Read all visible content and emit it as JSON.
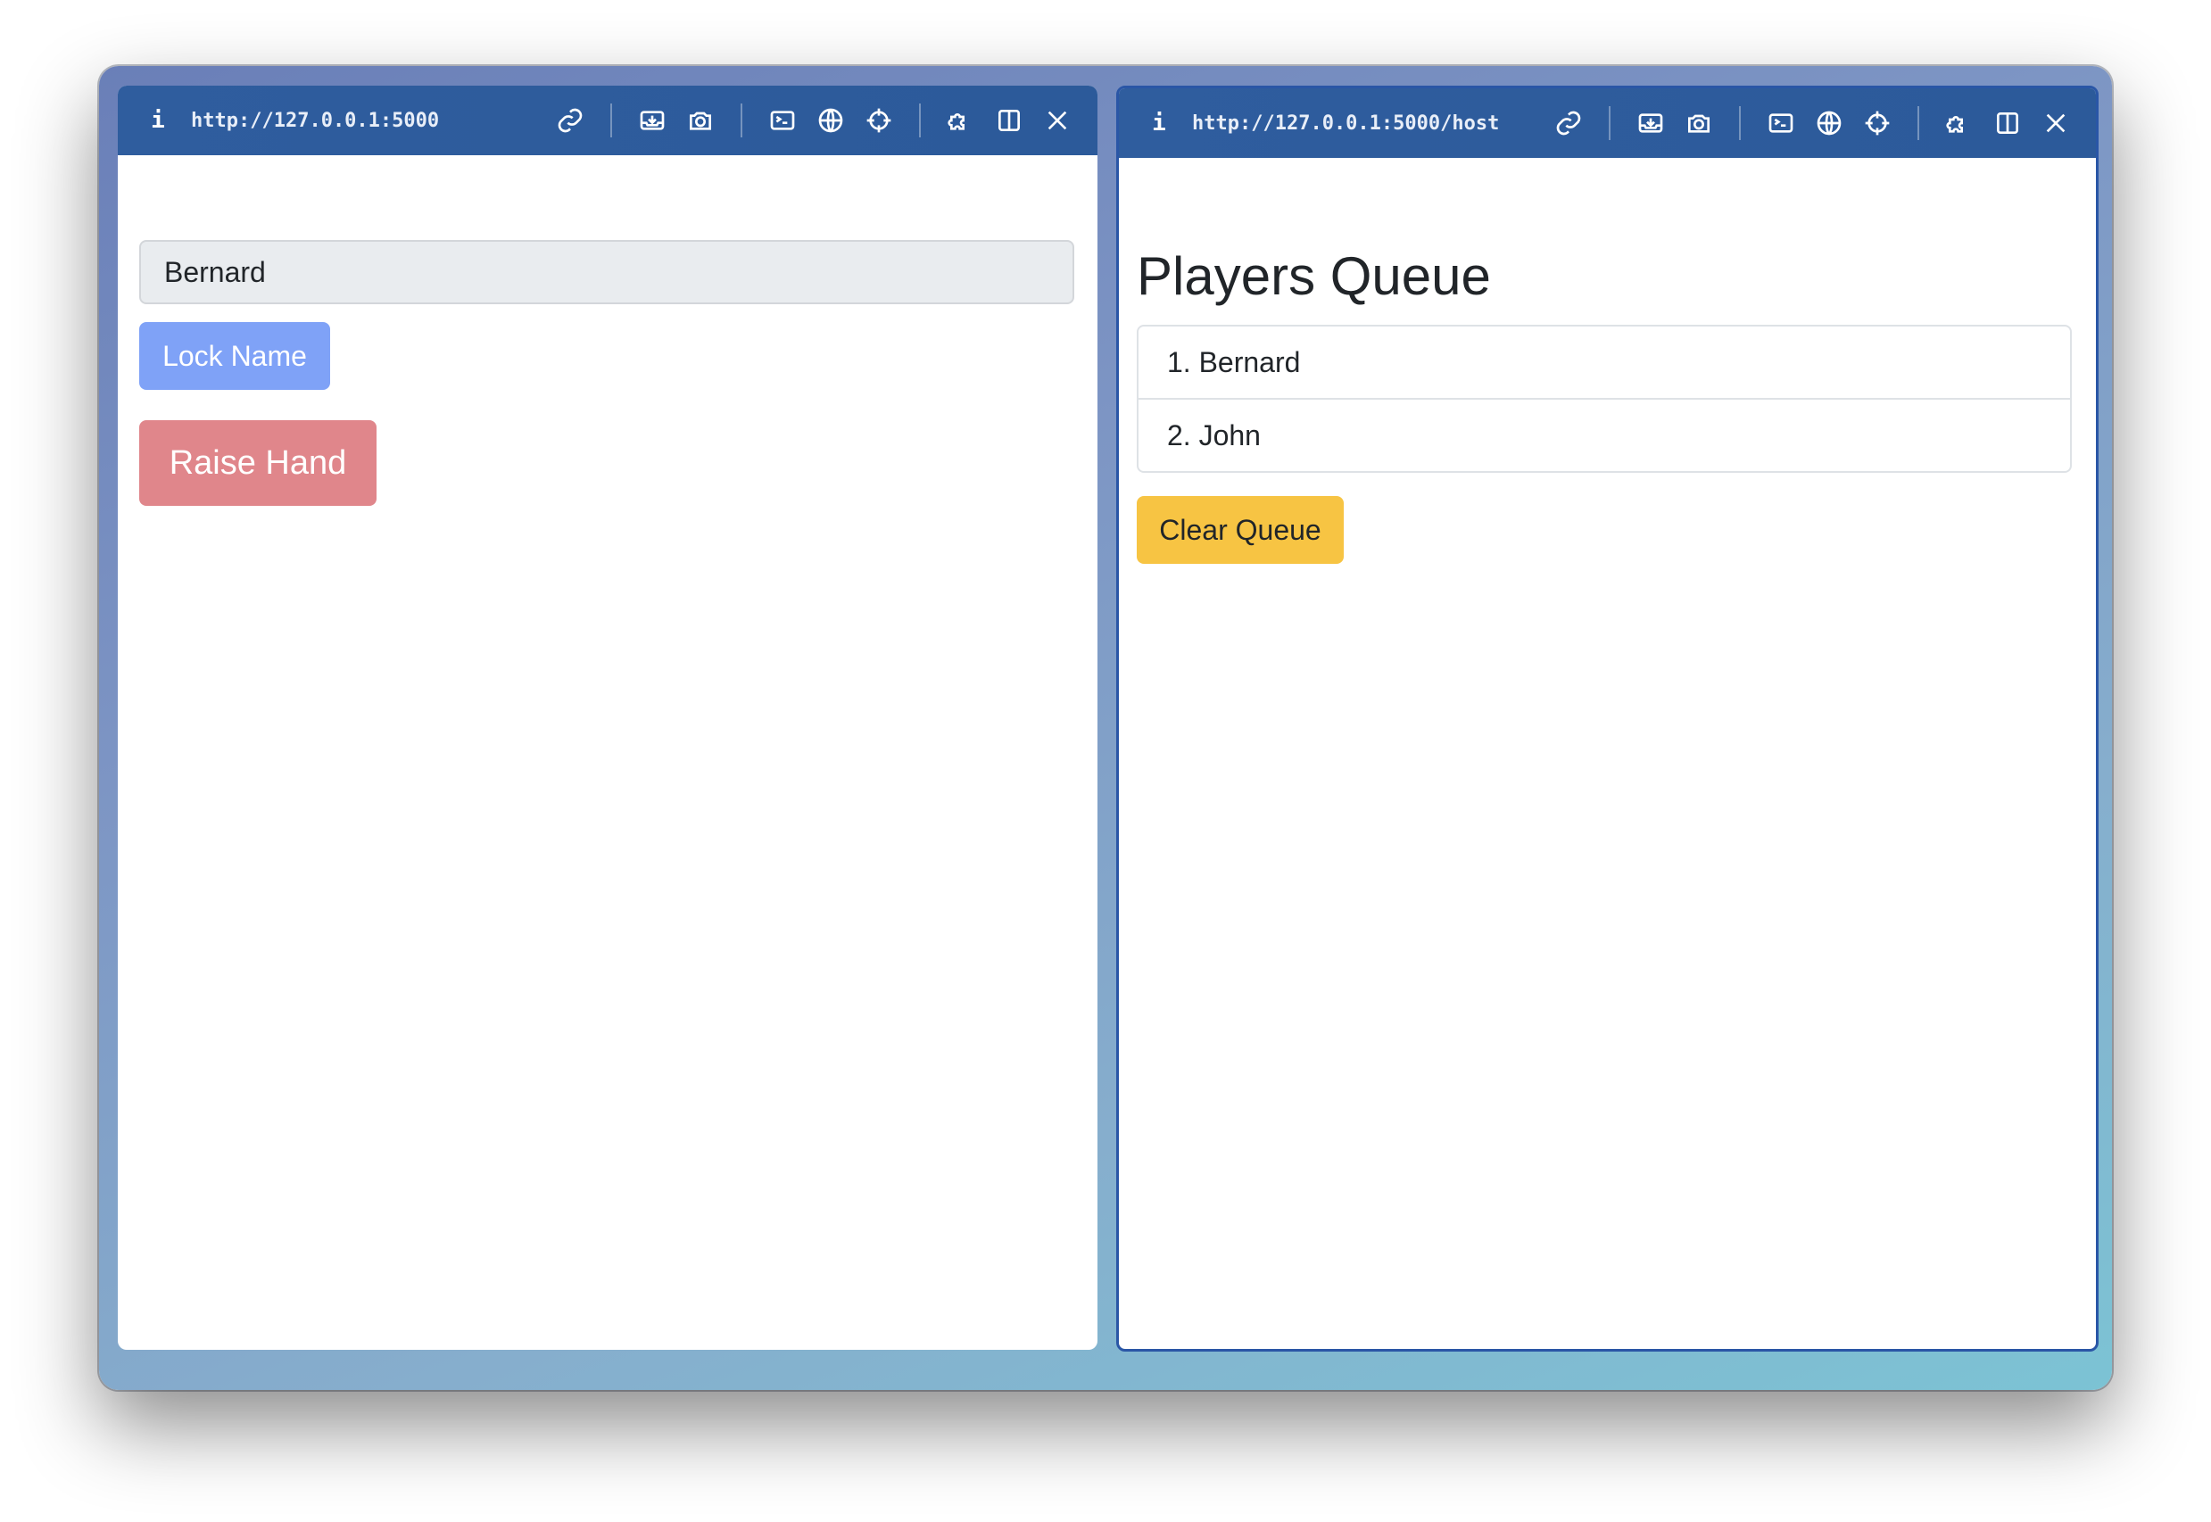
{
  "left_pane": {
    "url": "http://127.0.0.1:5000",
    "name_value": "Bernard",
    "lock_label": "Lock Name",
    "raise_label": "Raise Hand",
    "colors": {
      "lock_button": "#7fa2f7",
      "raise_button": "#e0868b"
    }
  },
  "right_pane": {
    "url": "http://127.0.0.1:5000/host",
    "title": "Players Queue",
    "queue": [
      "1. Bernard",
      "2. John"
    ],
    "clear_label": "Clear Queue",
    "colors": {
      "clear_button": "#f7c443"
    }
  },
  "toolbar": {
    "info_label": "i",
    "icons": [
      "link-icon",
      "inbox-download-icon",
      "camera-icon",
      "terminal-icon",
      "globe-icon",
      "crosshair-icon",
      "puzzle-icon",
      "split-view-icon",
      "close-icon"
    ],
    "accent": "#2f5d9e"
  }
}
